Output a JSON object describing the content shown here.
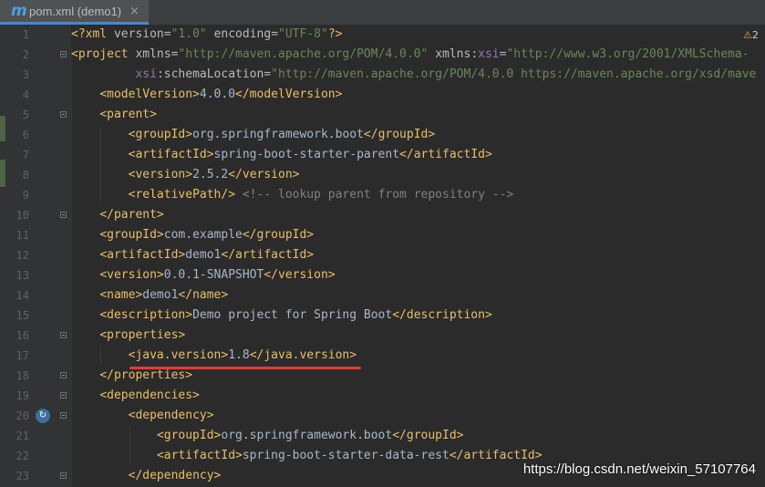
{
  "tab": {
    "icon": "maven-m-icon",
    "title": "pom.xml (demo1)",
    "close": "×"
  },
  "warning": {
    "icon": "warning-icon",
    "count": "2"
  },
  "watermark": "https://blog.csdn.net/weixin_57107764",
  "colors": {
    "tag": "#e8bf6a",
    "attribute": "#bababa",
    "namespace": "#9876aa",
    "string": "#6a8759",
    "comment": "#808080",
    "text": "#a9b7c6",
    "underline": "#e53b3b"
  },
  "lines": [
    {
      "n": "1",
      "segs": [
        [
          "tag",
          "<?xml "
        ],
        [
          "attr",
          "version"
        ],
        [
          "txt",
          "="
        ],
        [
          "str",
          "\"1.0\""
        ],
        [
          "txt",
          " "
        ],
        [
          "attr",
          "encoding"
        ],
        [
          "txt",
          "="
        ],
        [
          "str",
          "\"UTF-8\""
        ],
        [
          "tag",
          "?>"
        ]
      ]
    },
    {
      "n": "2",
      "fold": true,
      "segs": [
        [
          "tag",
          "<project "
        ],
        [
          "attr",
          "xmlns"
        ],
        [
          "txt",
          "="
        ],
        [
          "str",
          "\"http://maven.apache.org/POM/4.0.0\""
        ],
        [
          "txt",
          " "
        ],
        [
          "attr",
          "xmlns"
        ],
        [
          "txt",
          ":"
        ],
        [
          "ns",
          "xsi"
        ],
        [
          "txt",
          "="
        ],
        [
          "str",
          "\"http://www.w3.org/2001/XMLSchema-"
        ]
      ]
    },
    {
      "n": "3",
      "segs": [
        [
          "txt",
          "         "
        ],
        [
          "ns",
          "xsi"
        ],
        [
          "txt",
          ":"
        ],
        [
          "attr",
          "schemaLocation"
        ],
        [
          "txt",
          "="
        ],
        [
          "str",
          "\"http://maven.apache.org/POM/4.0.0 https://maven.apache.org/xsd/mave"
        ]
      ]
    },
    {
      "n": "4",
      "segs": [
        [
          "txt",
          "    "
        ],
        [
          "tag",
          "<modelVersion>"
        ],
        [
          "txt",
          "4.0.0"
        ],
        [
          "tag",
          "</modelVersion>"
        ]
      ]
    },
    {
      "n": "5",
      "fold": true,
      "segs": [
        [
          "txt",
          "    "
        ],
        [
          "tag",
          "<parent>"
        ]
      ]
    },
    {
      "n": "6",
      "segs": [
        [
          "txt",
          "        "
        ],
        [
          "tag",
          "<groupId>"
        ],
        [
          "txt",
          "org.springframework.boot"
        ],
        [
          "tag",
          "</groupId>"
        ]
      ]
    },
    {
      "n": "7",
      "segs": [
        [
          "txt",
          "        "
        ],
        [
          "tag",
          "<artifactId>"
        ],
        [
          "txt",
          "spring-boot-starter-parent"
        ],
        [
          "tag",
          "</artifactId>"
        ]
      ]
    },
    {
      "n": "8",
      "segs": [
        [
          "txt",
          "        "
        ],
        [
          "tag",
          "<version>"
        ],
        [
          "txt",
          "2.5.2"
        ],
        [
          "tag",
          "</version>"
        ]
      ]
    },
    {
      "n": "9",
      "segs": [
        [
          "txt",
          "        "
        ],
        [
          "tag",
          "<relativePath/>"
        ],
        [
          "txt",
          " "
        ],
        [
          "cmt",
          "<!-- lookup parent from repository -->"
        ]
      ]
    },
    {
      "n": "10",
      "fold": true,
      "segs": [
        [
          "txt",
          "    "
        ],
        [
          "tag",
          "</parent>"
        ]
      ]
    },
    {
      "n": "11",
      "segs": [
        [
          "txt",
          "    "
        ],
        [
          "tag",
          "<groupId>"
        ],
        [
          "txt",
          "com.example"
        ],
        [
          "tag",
          "</groupId>"
        ]
      ]
    },
    {
      "n": "12",
      "segs": [
        [
          "txt",
          "    "
        ],
        [
          "tag",
          "<artifactId>"
        ],
        [
          "txt",
          "demo1"
        ],
        [
          "tag",
          "</artifactId>"
        ]
      ]
    },
    {
      "n": "13",
      "segs": [
        [
          "txt",
          "    "
        ],
        [
          "tag",
          "<version>"
        ],
        [
          "txt",
          "0.0.1-SNAPSHOT"
        ],
        [
          "tag",
          "</version>"
        ]
      ]
    },
    {
      "n": "14",
      "segs": [
        [
          "txt",
          "    "
        ],
        [
          "tag",
          "<name>"
        ],
        [
          "txt",
          "demo1"
        ],
        [
          "tag",
          "</name>"
        ]
      ]
    },
    {
      "n": "15",
      "segs": [
        [
          "txt",
          "    "
        ],
        [
          "tag",
          "<description>"
        ],
        [
          "txt",
          "Demo project for Spring Boot"
        ],
        [
          "tag",
          "</description>"
        ]
      ]
    },
    {
      "n": "16",
      "fold": true,
      "segs": [
        [
          "txt",
          "    "
        ],
        [
          "tag",
          "<properties>"
        ]
      ]
    },
    {
      "n": "17",
      "segs": [
        [
          "txt",
          "        "
        ],
        [
          "tag",
          "<java.version>"
        ],
        [
          "txt",
          "1.8"
        ],
        [
          "tag",
          "</java.version>"
        ]
      ]
    },
    {
      "n": "18",
      "fold": true,
      "segs": [
        [
          "txt",
          "    "
        ],
        [
          "tag",
          "</properties>"
        ]
      ]
    },
    {
      "n": "19",
      "fold": true,
      "segs": [
        [
          "txt",
          "    "
        ],
        [
          "tag",
          "<dependencies>"
        ]
      ]
    },
    {
      "n": "20",
      "fold": true,
      "gicon": true,
      "segs": [
        [
          "txt",
          "        "
        ],
        [
          "tag",
          "<dependency>"
        ]
      ]
    },
    {
      "n": "21",
      "segs": [
        [
          "txt",
          "            "
        ],
        [
          "tag",
          "<groupId>"
        ],
        [
          "txt",
          "org.springframework.boot"
        ],
        [
          "tag",
          "</groupId>"
        ]
      ]
    },
    {
      "n": "22",
      "segs": [
        [
          "txt",
          "            "
        ],
        [
          "tag",
          "<artifactId>"
        ],
        [
          "txt",
          "spring-boot-starter-data-rest"
        ],
        [
          "tag",
          "</artifactId>"
        ]
      ]
    },
    {
      "n": "23",
      "fold": true,
      "segs": [
        [
          "txt",
          "        "
        ],
        [
          "tag",
          "</dependency>"
        ]
      ]
    }
  ]
}
